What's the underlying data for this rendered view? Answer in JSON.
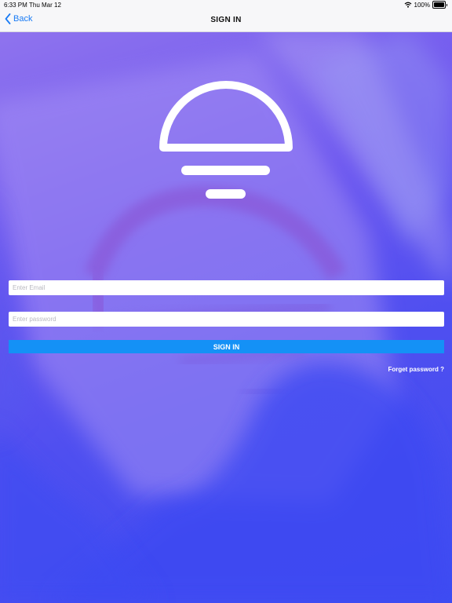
{
  "status_bar": {
    "time": "6:33 PM",
    "date": "Thu Mar 12",
    "battery": "100%"
  },
  "nav": {
    "back_label": "Back",
    "title": "SIGN IN"
  },
  "form": {
    "email_placeholder": "Enter Email",
    "email_value": "",
    "password_placeholder": "Enter password",
    "password_value": "",
    "signin_label": "SIGN IN",
    "forget_label": "Forget password ?"
  },
  "colors": {
    "accent": "#1491f6",
    "back_link": "#1a7cf5",
    "background_gradient_start": "#8f73ee",
    "background_gradient_end": "#3e4df2"
  },
  "icons": {
    "back": "chevron-left-icon",
    "wifi": "wifi-icon",
    "battery": "battery-icon",
    "logo": "lamp-logo-icon"
  }
}
